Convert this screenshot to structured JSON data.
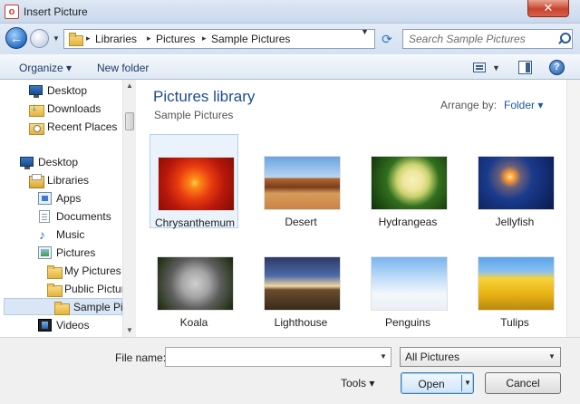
{
  "window": {
    "title": "Insert Picture",
    "close_glyph": "✕"
  },
  "address": {
    "crumbs": [
      "Libraries",
      "Pictures",
      "Sample Pictures"
    ],
    "separator_glyph": "▸",
    "search_placeholder": "Search Sample Pictures"
  },
  "toolbar": {
    "organize": "Organize ▾",
    "new_folder": "New folder",
    "help_glyph": "?"
  },
  "nav": {
    "items": [
      {
        "label": "Desktop"
      },
      {
        "label": "Downloads"
      },
      {
        "label": "Recent Places"
      },
      {
        "label": "Desktop"
      },
      {
        "label": "Libraries"
      },
      {
        "label": "Apps"
      },
      {
        "label": "Documents"
      },
      {
        "label": "Music"
      },
      {
        "label": "Pictures"
      },
      {
        "label": "My Pictures"
      },
      {
        "label": "Public Pictur"
      },
      {
        "label": "Sample Pic"
      },
      {
        "label": "Videos"
      }
    ]
  },
  "main": {
    "library_title": "Pictures library",
    "library_subtitle": "Sample Pictures",
    "arrange_label": "Arrange by:",
    "arrange_value": "Folder ▾",
    "thumbnails": [
      {
        "label": "Chrysanthemum"
      },
      {
        "label": "Desert"
      },
      {
        "label": "Hydrangeas"
      },
      {
        "label": "Jellyfish"
      },
      {
        "label": "Koala"
      },
      {
        "label": "Lighthouse"
      },
      {
        "label": "Penguins"
      },
      {
        "label": "Tulips"
      }
    ]
  },
  "bottom": {
    "file_name_label": "File name:",
    "file_name_value": "",
    "file_type": "All Pictures",
    "tools": "Tools ▾",
    "open": "Open",
    "cancel": "Cancel"
  }
}
